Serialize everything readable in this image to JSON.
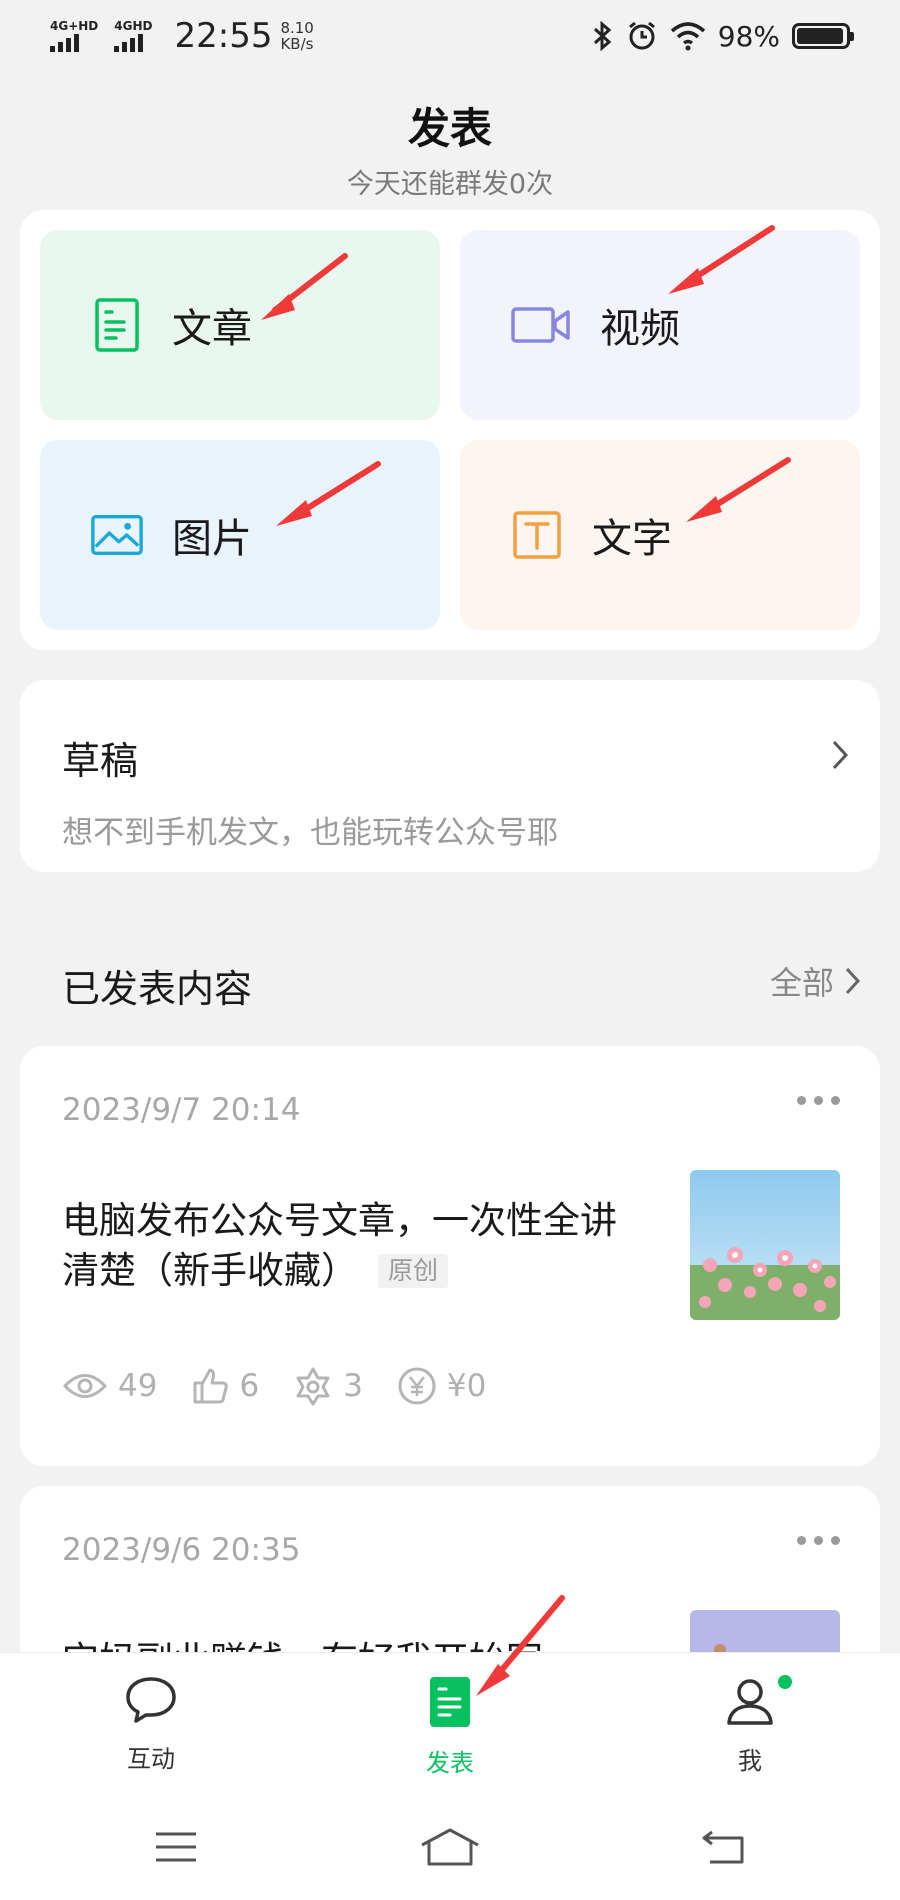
{
  "status_bar": {
    "sim1": "4G+HD",
    "sim2": "4GHD",
    "time": "22:55",
    "speed_value": "8.10",
    "speed_unit": "KB/s",
    "battery": "98%"
  },
  "header": {
    "title": "发表",
    "subtitle": "今天还能群发0次"
  },
  "publish_options": {
    "article": "文章",
    "video": "视频",
    "image": "图片",
    "text": "文字"
  },
  "draft": {
    "title": "草稿",
    "description": "想不到手机发文，也能玩转公众号耶"
  },
  "published_section": {
    "title": "已发表内容",
    "all_label": "全部"
  },
  "posts": [
    {
      "date": "2023/9/7 20:14",
      "title": "电脑发布公众号文章，一次性全讲清楚（新手收藏）",
      "badge": "原创",
      "views": "49",
      "likes": "6",
      "shares": "3",
      "earnings": "¥0"
    },
    {
      "date": "2023/9/6 20:35",
      "title": "宝妈副业赚钱，有好我开始写"
    }
  ],
  "tab_bar": {
    "interact": "互动",
    "publish": "发表",
    "me": "我"
  },
  "colors": {
    "accent_green": "#07c160",
    "annotation_red": "#f03a3a"
  }
}
